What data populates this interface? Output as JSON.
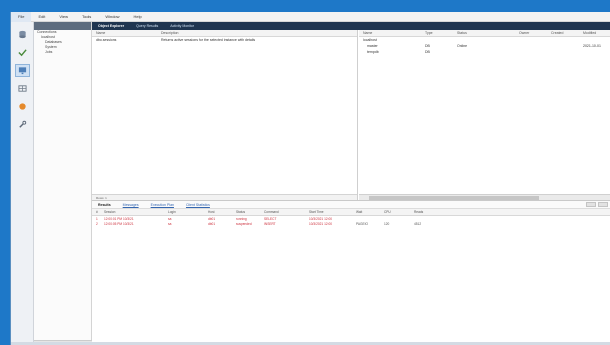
{
  "menu": [
    "File",
    "Edit",
    "View",
    "Tools",
    "Window",
    "Help"
  ],
  "rail_icons": [
    "database-icon",
    "check-icon",
    "monitor-icon",
    "grid-icon",
    "orange-circle-icon",
    "wrench-icon"
  ],
  "tree": {
    "items": [
      "Connections",
      "localhost",
      "Databases",
      "System",
      "Jobs"
    ],
    "status": ""
  },
  "top_tabs": [
    "Object Explorer",
    "Query Results",
    "Activity Monitor"
  ],
  "left_pane": {
    "columns": [
      "Name",
      "Description"
    ],
    "rows": [
      {
        "name": "dbo.sessions",
        "desc": "Returns active sessions for the selected instance with details"
      }
    ],
    "footer": "Rows: 1"
  },
  "right_pane": {
    "columns": [
      "Name",
      "Type",
      "Status",
      "Owner",
      "Created",
      "Modified"
    ],
    "rows": [
      {
        "name": "localhost",
        "type": "",
        "status": "",
        "owner": "",
        "created": "",
        "modified": ""
      },
      {
        "name": "master",
        "type": "DB",
        "status": "Online",
        "owner": "",
        "created": "",
        "modified": "2021-10-01"
      },
      {
        "name": "tempdb",
        "type": "DB",
        "status": "",
        "owner": "",
        "created": "",
        "modified": ""
      }
    ]
  },
  "lower_tabs": [
    "Results",
    "Messages",
    "Execution Plan",
    "Client Statistics"
  ],
  "results": {
    "columns": [
      "#",
      "Session",
      "Login",
      "Host",
      "Status",
      "Command",
      "Start Time",
      "Wait",
      "CPU",
      "Reads"
    ],
    "rows": [
      {
        "n": "1",
        "session": "12:00:01 PM 10/3/21",
        "login": "sa",
        "host": "db01",
        "status": "running",
        "command": "SELECT",
        "start": "10/3/2021 12:00",
        "wait": "",
        "cpu": "",
        "reads": ""
      },
      {
        "n": "2",
        "session": "12:00:05 PM 10/3/21",
        "login": "sa",
        "host": "db01",
        "status": "suspended",
        "command": "INSERT",
        "start": "10/3/2021 12:00",
        "wait": "PAGEIO",
        "cpu": "120",
        "reads": "4512"
      }
    ]
  }
}
